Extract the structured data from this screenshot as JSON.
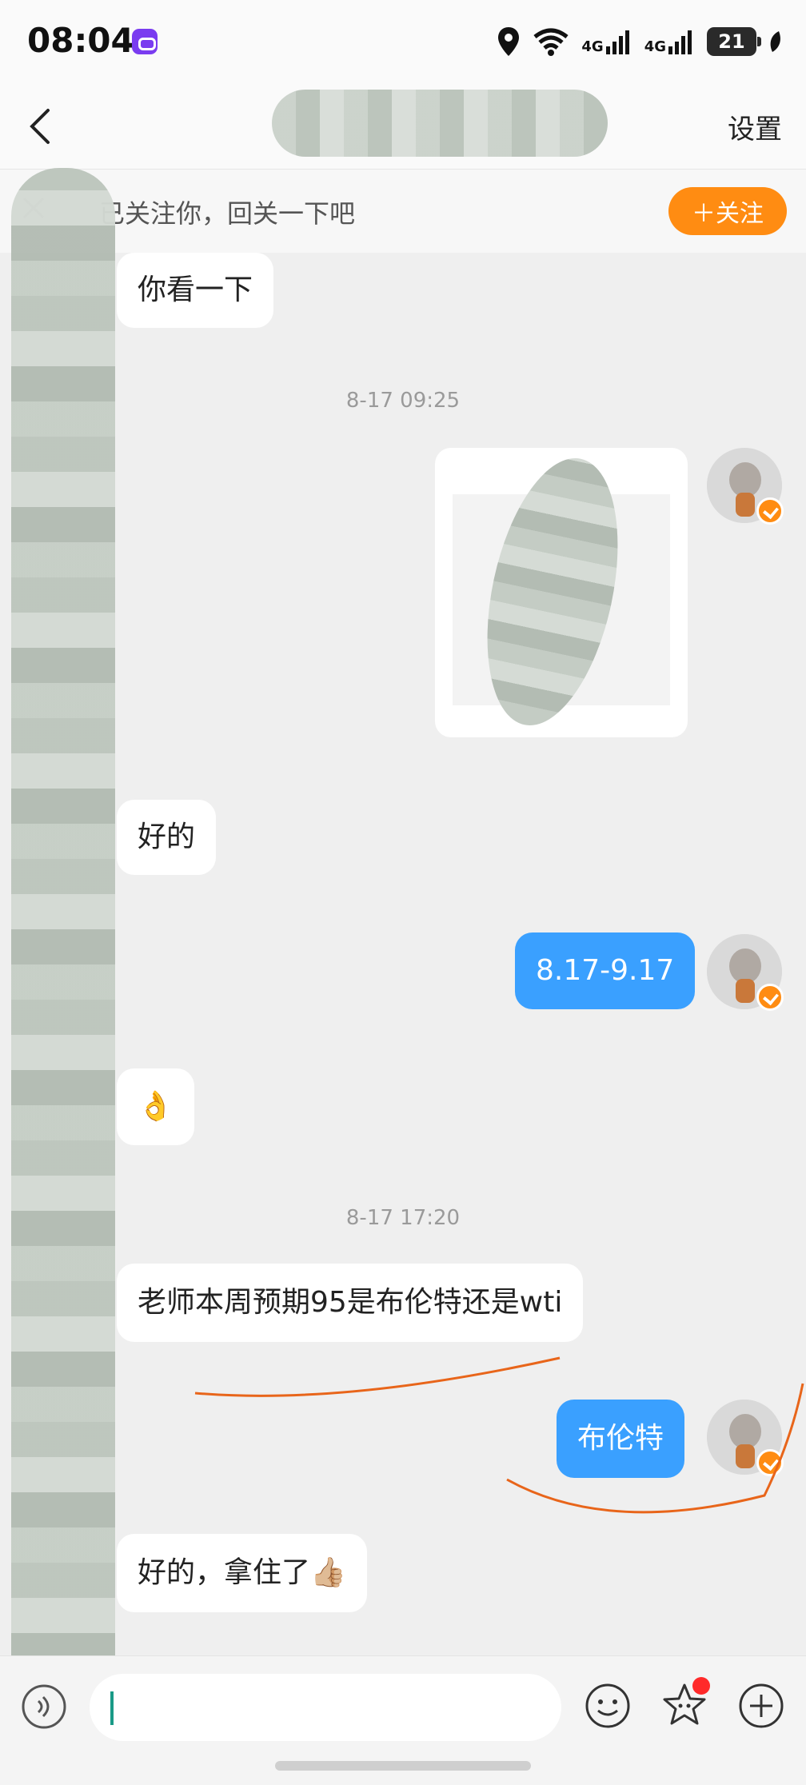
{
  "status_bar": {
    "time": "08:04",
    "network_1": "4G",
    "network_2": "4G",
    "battery": "21"
  },
  "header": {
    "back_icon": "chevron-left-icon",
    "settings_label": "设置"
  },
  "follow_banner": {
    "text": "已关注你，回关一下吧",
    "button_label": "＋关注",
    "accent": "#ff8c12"
  },
  "messages": {
    "m1": "你看一下",
    "ts1": "8-17 09:25",
    "m3": "好的",
    "m4": "8.17-9.17",
    "m5": "👌",
    "ts2": "8-17 17:20",
    "m6": "老师本周预期95是布伦特还是wti",
    "m7": "布伦特",
    "m8": "好的，拿住了👍🏼"
  },
  "colors": {
    "outgoing_bubble": "#3aa0ff",
    "incoming_bubble": "#ffffff",
    "background": "#efefef",
    "annotation_line": "#e8651a"
  },
  "input_bar": {
    "placeholder": ""
  }
}
